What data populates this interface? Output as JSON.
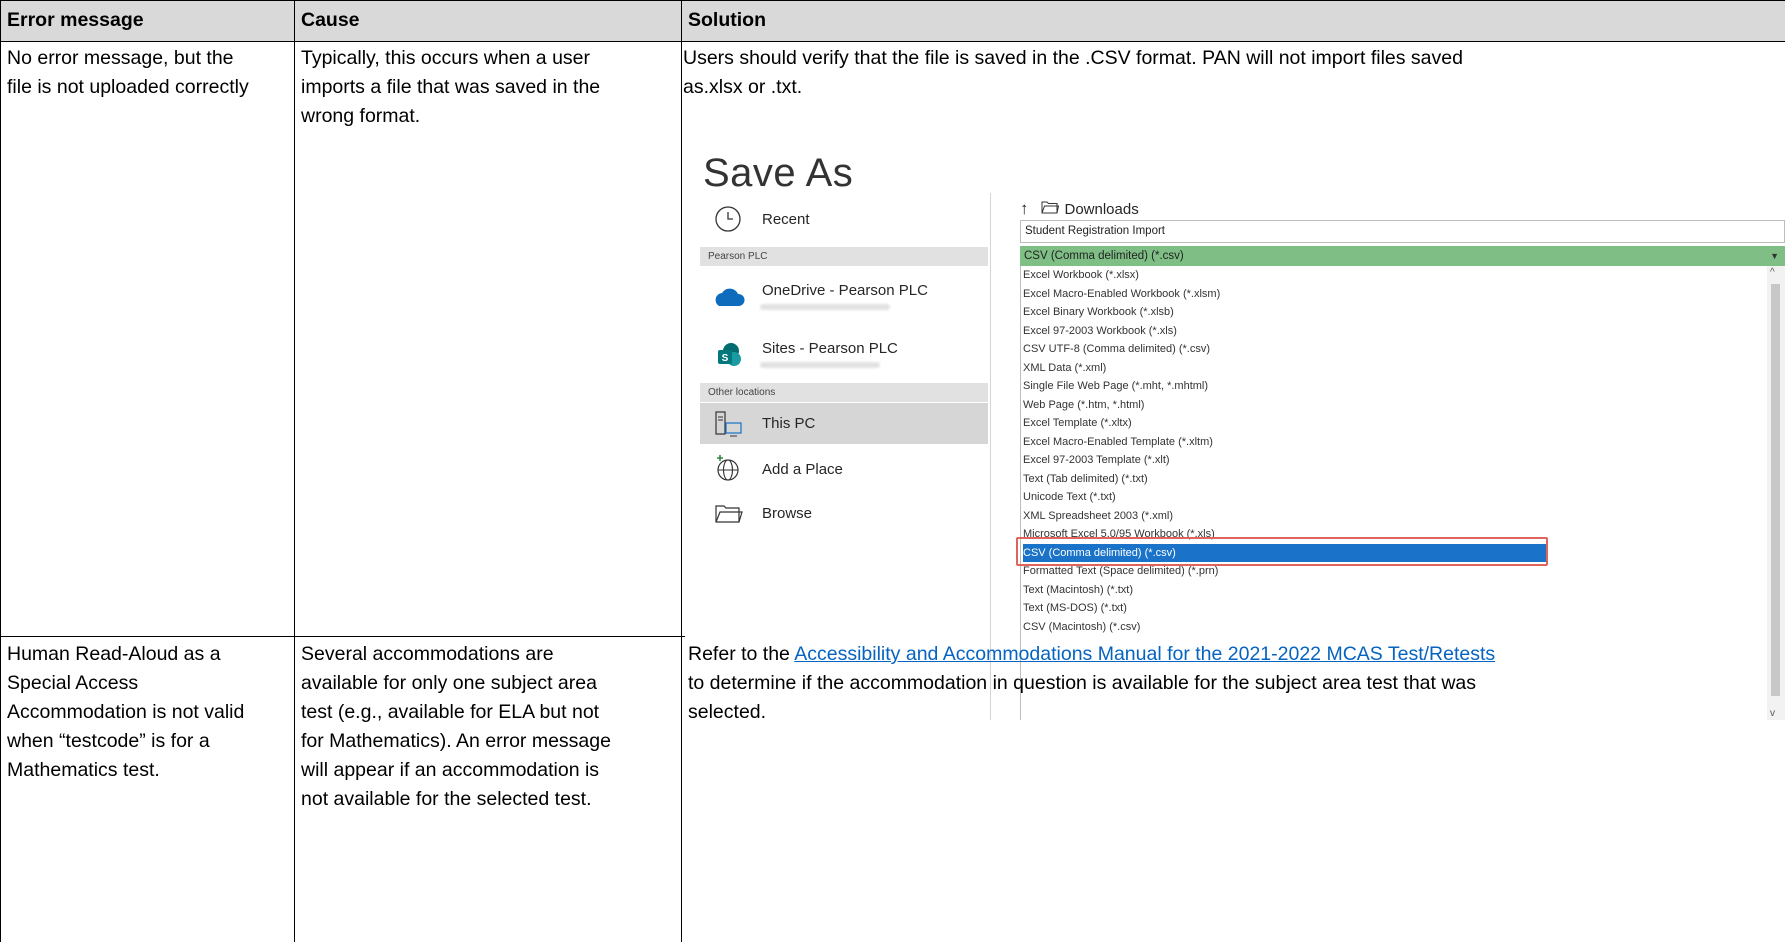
{
  "headers": {
    "error_message": "Error message",
    "cause": "Cause",
    "solution": "Solution"
  },
  "rows": [
    {
      "error_lines": [
        "No error message, but the",
        "file is not uploaded correctly"
      ],
      "cause_lines": [
        "Typically, this occurs when a user",
        "imports a file that was saved in the",
        "wrong format."
      ],
      "solution_lines": [
        "Users should verify that the file is saved in the .CSV format. PAN will not import files saved",
        "as.xlsx or .txt."
      ]
    },
    {
      "error_lines": [
        "Human Read-Aloud as a",
        "Special Access",
        "Accommodation is not valid",
        "when “testcode” is for a",
        "Mathematics test."
      ],
      "cause_lines": [
        "Several accommodations are",
        "available for only one subject area",
        "test (e.g., available for ELA but not",
        "for Mathematics). An error message",
        "will appear if an accommodation is",
        "not available for the selected test."
      ],
      "solution_prefix": "Refer to the ",
      "solution_link": "Accessibility and Accommodations Manual for the 2021-2022 MCAS Test/Retests",
      "solution_rest_lines": [
        "to determine if the accommodation in question is available for the subject area test that was",
        "selected."
      ]
    }
  ],
  "save_as": {
    "title": "Save As",
    "recent": "Recent",
    "section_pearson": "Pearson PLC",
    "onedrive": "OneDrive - Pearson PLC",
    "sites": "Sites - Pearson PLC",
    "section_other": "Other locations",
    "this_pc": "This PC",
    "add_place": "Add a Place",
    "browse": "Browse",
    "folder": "Downloads",
    "file_name": "Student Registration Import",
    "file_type": "CSV (Comma delimited) (*.csv)",
    "options": [
      "Excel Workbook (*.xlsx)",
      "Excel Macro-Enabled Workbook (*.xlsm)",
      "Excel Binary Workbook (*.xlsb)",
      "Excel 97-2003 Workbook (*.xls)",
      "CSV UTF-8 (Comma delimited) (*.csv)",
      "XML Data (*.xml)",
      "Single File Web Page (*.mht, *.mhtml)",
      "Web Page (*.htm, *.html)",
      "Excel Template (*.xltx)",
      "Excel Macro-Enabled Template (*.xltm)",
      "Excel 97-2003 Template (*.xlt)",
      "Text (Tab delimited) (*.txt)",
      "Unicode Text (*.txt)",
      "XML Spreadsheet 2003 (*.xml)",
      "Microsoft Excel 5.0/95 Workbook (*.xls)",
      "CSV (Comma delimited) (*.csv)",
      "Formatted Text (Space delimited) (*.prn)",
      "Text (Macintosh) (*.txt)",
      "Text (MS-DOS) (*.txt)",
      "CSV (Macintosh) (*.csv)"
    ],
    "selected_option_index": 15,
    "colors": {
      "selection": "#1a73c9",
      "highlight_box": "#e0635c",
      "file_type_bar": "#7fbf86"
    }
  }
}
